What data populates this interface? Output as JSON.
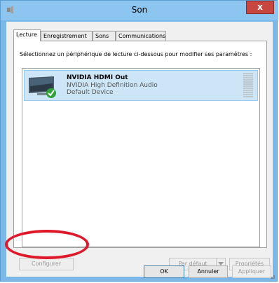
{
  "window": {
    "title": "Son",
    "close_label": "x"
  },
  "tabs": [
    {
      "label": "Lecture",
      "active": true
    },
    {
      "label": "Enregistrement",
      "active": false
    },
    {
      "label": "Sons",
      "active": false
    },
    {
      "label": "Communications",
      "active": false
    }
  ],
  "instruction": "Sélectionnez un périphérique de lecture ci-dessous pour modifier ses paramètres :",
  "devices": [
    {
      "name": "NVIDIA HDMI Out",
      "description": "NVIDIA High Definition Audio",
      "status": "Default Device",
      "icon": "monitor-icon",
      "badge": "green-check-icon"
    }
  ],
  "panel_buttons": {
    "configure": "Configurer",
    "set_default": "Par défaut",
    "properties": "Propriétés"
  },
  "dialog_buttons": {
    "ok": "OK",
    "cancel": "Annuler",
    "apply": "Appliquer"
  },
  "colors": {
    "titlebar": "#8cc5f0",
    "close": "#c7463f",
    "selection": "#cde6f7",
    "highlight_oval": "#e0192a"
  }
}
